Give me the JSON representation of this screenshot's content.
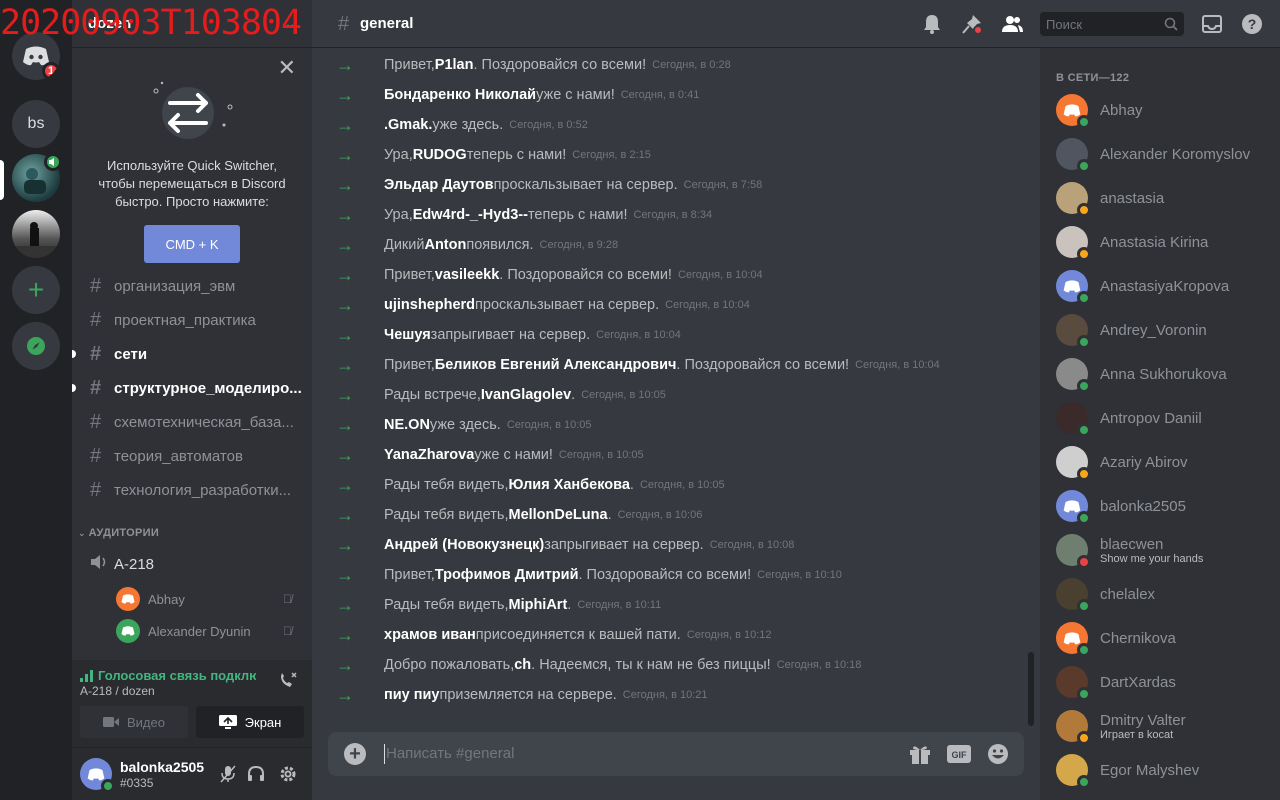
{
  "stamp": "20200903T103804",
  "server": {
    "name": "dozen"
  },
  "guilds": [
    {
      "label": "bs"
    }
  ],
  "dm_badge": "1",
  "quick_switcher": {
    "text": "Используйте Quick Switcher, чтобы перемещаться в Discord быстро. Просто нажмите:",
    "button": "CMD + K"
  },
  "channels": [
    {
      "name": "организация_эвм",
      "unread": false
    },
    {
      "name": "проектная_практика",
      "unread": false
    },
    {
      "name": "сети",
      "unread": true
    },
    {
      "name": "структурное_моделиро...",
      "unread": true
    },
    {
      "name": "схемотехническая_база...",
      "unread": false
    },
    {
      "name": "теория_автоматов",
      "unread": false
    },
    {
      "name": "технология_разработки...",
      "unread": false
    }
  ],
  "stages_header": "АУДИТОРИИ",
  "voice_channel": {
    "name": "А-218",
    "users": [
      "Abhay",
      "Alexander Dyunin"
    ]
  },
  "voice_panel": {
    "status": "Голосовая связь подключ",
    "location": "А-218 / dozen",
    "video": "Видео",
    "screen": "Экран"
  },
  "user_panel": {
    "name": "balonka2505",
    "tag": "#0335"
  },
  "chat": {
    "channel": "general",
    "search_placeholder": "Поиск",
    "input_placeholder": "Написать #general",
    "messages": [
      {
        "pre": "Привет, ",
        "user": "P1lan",
        "post": ". Поздоровайся со всеми!",
        "time": "Сегодня, в 0:28"
      },
      {
        "pre": "",
        "user": "Бондаренко Николай",
        "post": " уже с нами!",
        "time": "Сегодня, в 0:41"
      },
      {
        "pre": "",
        "user": ".Gmak.",
        "post": " уже здесь.",
        "time": "Сегодня, в 0:52"
      },
      {
        "pre": "Ура, ",
        "user": "RUDOG",
        "post": " теперь с нами!",
        "time": "Сегодня, в 2:15"
      },
      {
        "pre": "",
        "user": "Эльдар Даутов",
        "post": " проскальзывает на сервер.",
        "time": "Сегодня, в 7:58"
      },
      {
        "pre": "Ура, ",
        "user": "Edw4rd-_-Hyd3--",
        "post": " теперь с нами!",
        "time": "Сегодня, в 8:34"
      },
      {
        "pre": "Дикий ",
        "user": "Anton",
        "post": " появился.",
        "time": "Сегодня, в 9:28"
      },
      {
        "pre": "Привет, ",
        "user": "vasileekk",
        "post": ". Поздоровайся со всеми!",
        "time": "Сегодня, в 10:04"
      },
      {
        "pre": "",
        "user": "ujinshepherd",
        "post": " проскальзывает на сервер.",
        "time": "Сегодня, в 10:04"
      },
      {
        "pre": "",
        "user": "Чешуя",
        "post": " запрыгивает на сервер.",
        "time": "Сегодня, в 10:04"
      },
      {
        "pre": "Привет, ",
        "user": "Беликов Евгений Александрович",
        "post": ". Поздоровайся со всеми!",
        "time": "Сегодня, в 10:04"
      },
      {
        "pre": "Рады встрече, ",
        "user": "IvanGlagolev",
        "post": ".",
        "time": "Сегодня, в 10:05"
      },
      {
        "pre": "",
        "user": "NE.ON",
        "post": " уже здесь.",
        "time": "Сегодня, в 10:05"
      },
      {
        "pre": "",
        "user": "YanaZharova",
        "post": " уже с нами!",
        "time": "Сегодня, в 10:05"
      },
      {
        "pre": "Рады тебя видеть, ",
        "user": "Юлия Ханбекова",
        "post": ".",
        "time": "Сегодня, в 10:05"
      },
      {
        "pre": "Рады тебя видеть, ",
        "user": "MellonDeLuna",
        "post": ".",
        "time": "Сегодня, в 10:06"
      },
      {
        "pre": "",
        "user": "Андрей (Новокузнецк)",
        "post": " запрыгивает на сервер.",
        "time": "Сегодня, в 10:08"
      },
      {
        "pre": "Привет, ",
        "user": "Трофимов Дмитрий",
        "post": ". Поздоровайся со всеми!",
        "time": "Сегодня, в 10:10"
      },
      {
        "pre": "Рады тебя видеть, ",
        "user": "MiphiArt",
        "post": ".",
        "time": "Сегодня, в 10:11"
      },
      {
        "pre": "",
        "user": "храмов иван",
        "post": " присоединяется к вашей пати.",
        "time": "Сегодня, в 10:12"
      },
      {
        "pre": "Добро пожаловать, ",
        "user": "ch",
        "post": ". Надеемся, ты к нам не без пиццы!",
        "time": "Сегодня, в 10:18"
      },
      {
        "pre": "",
        "user": "пиу пиу",
        "post": " приземляется на сервере.",
        "time": "Сегодня, в 10:21"
      }
    ]
  },
  "members": {
    "header": "В СЕТИ—122",
    "list": [
      {
        "name": "Abhay",
        "sub": "",
        "color": "#f57731",
        "status": "online"
      },
      {
        "name": "Alexander Koromyslov",
        "sub": "",
        "color": "#4f5660",
        "status": "online"
      },
      {
        "name": "anastasia",
        "sub": "",
        "color": "#b9a27a",
        "status": "idle"
      },
      {
        "name": "Anastasia Kirina",
        "sub": "",
        "color": "#c9c2bd",
        "status": "idle"
      },
      {
        "name": "AnastasiyaKropova",
        "sub": "",
        "color": "#7289da",
        "status": "online"
      },
      {
        "name": "Andrey_Voronin",
        "sub": "",
        "color": "#5a4b3f",
        "status": "online"
      },
      {
        "name": "Anna Sukhorukova",
        "sub": "",
        "color": "#8a8a8a",
        "status": "online"
      },
      {
        "name": "Antropov Daniil",
        "sub": "",
        "color": "#3a2a2a",
        "status": "online"
      },
      {
        "name": "Azariy Abirov",
        "sub": "",
        "color": "#cfcfcf",
        "status": "idle"
      },
      {
        "name": "balonka2505",
        "sub": "",
        "color": "#7289da",
        "status": "online"
      },
      {
        "name": "blaecwen",
        "sub": "Show me your hands",
        "color": "#6f7f6f",
        "status": "dnd"
      },
      {
        "name": "chelalex",
        "sub": "",
        "color": "#4a4030",
        "status": "online"
      },
      {
        "name": "Chernikova",
        "sub": "",
        "color": "#f57731",
        "status": "online"
      },
      {
        "name": "DartXardas",
        "sub": "",
        "color": "#5a3a2a",
        "status": "online"
      },
      {
        "name": "Dmitry Valter",
        "sub": "Играет в kocat",
        "color": "#b27a3a",
        "status": "idle"
      },
      {
        "name": "Egor Malyshev",
        "sub": "",
        "color": "#d4a84a",
        "status": "online"
      }
    ]
  }
}
